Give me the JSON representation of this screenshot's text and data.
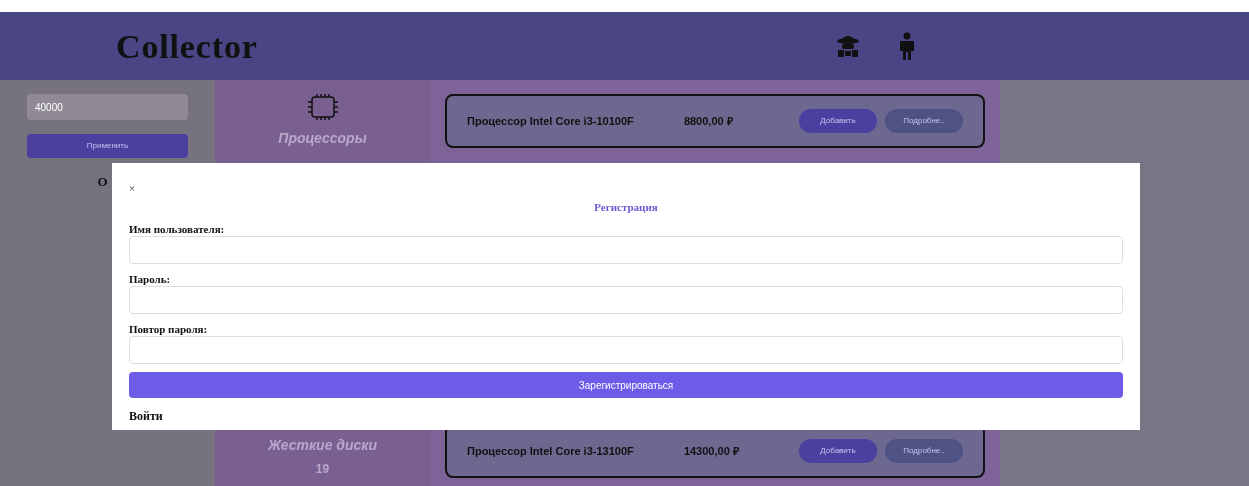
{
  "header": {
    "logo": "Collector"
  },
  "filter": {
    "value": "40000",
    "apply": "Применить",
    "note": "О"
  },
  "categories": [
    {
      "name": "Процессоры"
    },
    {
      "name": "Жесткие диски",
      "count": "19"
    }
  ],
  "products": [
    {
      "name": "Процессор Intel Core i3-10100F",
      "price": "8800,00 ₽",
      "add": "Добавить",
      "details": "Подробне.."
    },
    {
      "name": "Процессор Intel Core i3-13100F",
      "price": "14300,00 ₽",
      "add": "Добавить",
      "details": "Подробне.."
    }
  ],
  "modal": {
    "close": "×",
    "title": "Регистрация",
    "fields": [
      {
        "label": "Имя пользователя:"
      },
      {
        "label": "Пароль:"
      },
      {
        "label": "Повтор пароля:"
      }
    ],
    "submit": "Зарегистрироваться",
    "login": "Войти"
  }
}
